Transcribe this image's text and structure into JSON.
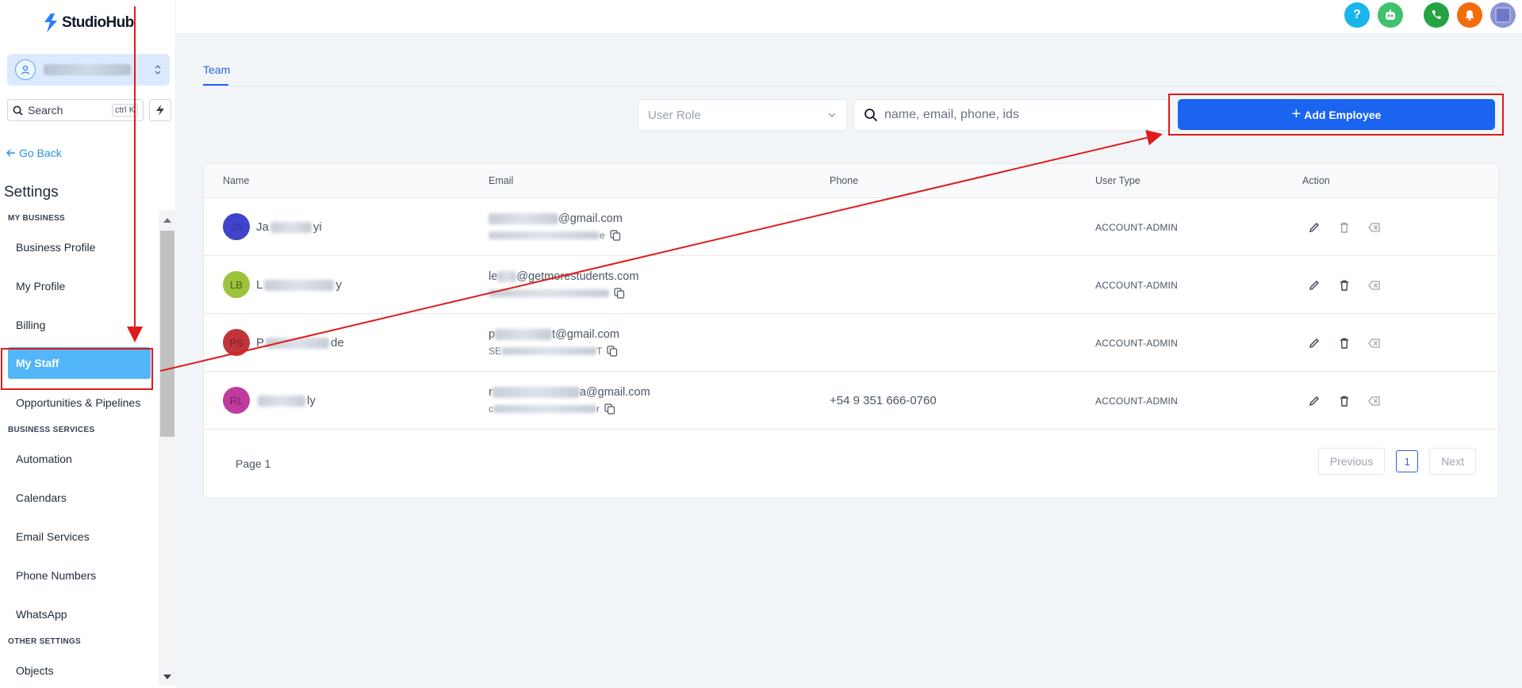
{
  "app": {
    "brand": "StudioHub"
  },
  "sidebar": {
    "search_label": "Search",
    "search_shortcut": "ctrl K",
    "go_back": "Go Back",
    "settings_title": "Settings",
    "sections": [
      {
        "title": "MY BUSINESS",
        "items": [
          "Business Profile",
          "My Profile",
          "Billing",
          "My Staff",
          "Opportunities & Pipelines"
        ]
      },
      {
        "title": "BUSINESS SERVICES",
        "items": [
          "Automation",
          "Calendars",
          "Email Services",
          "Phone Numbers",
          "WhatsApp"
        ]
      },
      {
        "title": "OTHER SETTINGS",
        "items": [
          "Objects"
        ]
      }
    ],
    "active_item": "My Staff"
  },
  "topbar": {
    "icons": [
      {
        "name": "help-icon",
        "glyph": "?",
        "color": "#1ab5ea"
      },
      {
        "name": "ai-bot-icon",
        "glyph": "",
        "color": "#3ec26b"
      },
      {
        "name": "phone-icon",
        "glyph": "",
        "color": "#25a244"
      },
      {
        "name": "notifications-icon",
        "glyph": "",
        "color": "#f56c0c"
      },
      {
        "name": "user-avatar-icon",
        "glyph": "",
        "color": "#8b93d6"
      }
    ]
  },
  "main": {
    "tab": "Team",
    "role_placeholder": "User Role",
    "search_placeholder": "name, email, phone, ids",
    "add_button": "Add Employee",
    "table": {
      "columns": [
        "Name",
        "Email",
        "Phone",
        "User Type",
        "Action"
      ],
      "rows": [
        {
          "initials": "JA",
          "avatar_bg": "#3f44c8",
          "avatar_fg": "#2e34a8",
          "name_start": "Ja",
          "name_end": "yi",
          "email_start": "",
          "email_end": "@gmail.com",
          "sub_end": "e",
          "phone": "",
          "user_type": "ACCOUNT-ADMIN"
        },
        {
          "initials": "LB",
          "avatar_bg": "#9cc33c",
          "avatar_fg": "#4b5f12",
          "name_start": "L",
          "name_end": "y",
          "email_start": "le",
          "email_end": "@getmorestudents.com",
          "sub_end": "",
          "phone": "",
          "user_type": "ACCOUNT-ADMIN"
        },
        {
          "initials": "PS",
          "avatar_bg": "#c0353c",
          "avatar_fg": "#7a1d22",
          "name_start": "P",
          "name_end": "de",
          "email_start": "p",
          "email_end": "t@gmail.com",
          "sub_start": "SE",
          "sub_end": "T",
          "phone": "",
          "user_type": "ACCOUNT-ADMIN"
        },
        {
          "initials": "RL",
          "avatar_bg": "#bf3b9e",
          "avatar_fg": "#7a2063",
          "name_start": "",
          "name_end": "ly",
          "email_start": "r",
          "email_end": "a@gmail.com",
          "sub_start": "c",
          "sub_end": "r",
          "phone": "+54 9 351 666-0760",
          "user_type": "ACCOUNT-ADMIN"
        }
      ]
    },
    "pagination": {
      "label": "Page 1",
      "previous": "Previous",
      "current": "1",
      "next": "Next"
    }
  },
  "colors": {
    "primary": "#1a64f0",
    "active_nav": "#52b6f8",
    "annotation": "#e01b1b"
  }
}
